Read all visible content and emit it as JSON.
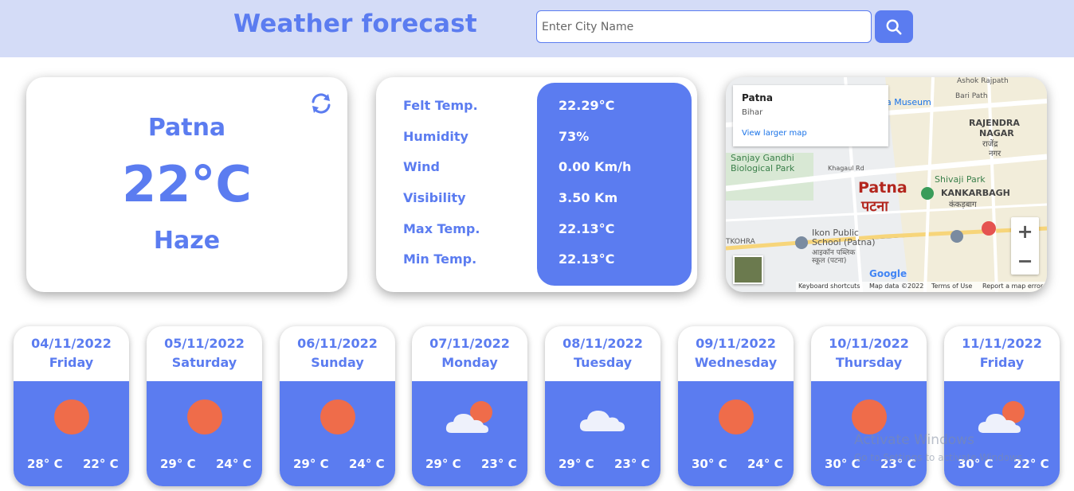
{
  "header": {
    "title": "Weather forecast",
    "search_placeholder": "Enter City Name",
    "search_icon": "search-icon"
  },
  "current": {
    "city": "Patna",
    "temperature": "22°C",
    "condition": "Haze",
    "refresh_icon": "refresh-icon"
  },
  "details": {
    "rows": [
      {
        "label": "Felt Temp.",
        "value": "22.29°C"
      },
      {
        "label": "Humidity",
        "value": "73%"
      },
      {
        "label": "Wind",
        "value": "0.00 Km/h"
      },
      {
        "label": "Visibility",
        "value": "3.50 Km"
      },
      {
        "label": "Max Temp.",
        "value": "22.13°C"
      },
      {
        "label": "Min Temp.",
        "value": "22.13°C"
      }
    ]
  },
  "map": {
    "place": "Patna",
    "region": "Bihar",
    "view_larger": "View larger map",
    "labels": {
      "museum": "na Museum",
      "bari_path": "Bari Path",
      "ashok_rajpath": "Ashok Rajpath",
      "rajendra_1": "RAJENDRA",
      "rajendra_2": "NAGAR",
      "rajendra_hi_1": "राजेंद्र",
      "rajendra_hi_2": "नगर",
      "sanjay_1": "Sanjay Gandhi",
      "sanjay_2": "Biological Park",
      "khagaul": "Khagaul Rd",
      "city_en": "Patna",
      "city_hi": "पटना",
      "shivaji": "Shivaji Park",
      "kankarbagh": "KANKARBAGH",
      "kankarbagh_hi": "कंकड़बाग",
      "ikon_1": "Ikon Public",
      "ikon_2": "School (Patna)",
      "ikon_hi_1": "आइकॉन पब्लिक",
      "ikon_hi_2": "स्कूल (पटना)",
      "tkohra": "TKOHRA",
      "google": "Google"
    },
    "footer": {
      "shortcuts": "Keyboard shortcuts",
      "data": "Map data ©2022",
      "terms": "Terms of Use",
      "report": "Report a map error"
    },
    "zoom_in": "+",
    "zoom_out": "−"
  },
  "forecast": [
    {
      "date": "04/11/2022",
      "day": "Friday",
      "max": "28° C",
      "min": "22° C",
      "icon": "sun-icon"
    },
    {
      "date": "05/11/2022",
      "day": "Saturday",
      "max": "29° C",
      "min": "24° C",
      "icon": "sun-icon"
    },
    {
      "date": "06/11/2022",
      "day": "Sunday",
      "max": "29° C",
      "min": "24° C",
      "icon": "sun-icon"
    },
    {
      "date": "07/11/2022",
      "day": "Monday",
      "max": "29° C",
      "min": "23° C",
      "icon": "partly-cloudy-icon"
    },
    {
      "date": "08/11/2022",
      "day": "Tuesday",
      "max": "29° C",
      "min": "23° C",
      "icon": "cloud-icon"
    },
    {
      "date": "09/11/2022",
      "day": "Wednesday",
      "max": "30° C",
      "min": "24° C",
      "icon": "sun-icon"
    },
    {
      "date": "10/11/2022",
      "day": "Thursday",
      "max": "30° C",
      "min": "23° C",
      "icon": "sun-icon"
    },
    {
      "date": "11/11/2022",
      "day": "Friday",
      "max": "30° C",
      "min": "22° C",
      "icon": "partly-cloudy-icon"
    }
  ],
  "watermark": {
    "title": "Activate Windows",
    "subtitle": "Go to Settings to activate Windows."
  },
  "colors": {
    "accent": "#5b7cf0",
    "header_bg": "#d4dcf7",
    "sun": "#ef6c4a"
  }
}
